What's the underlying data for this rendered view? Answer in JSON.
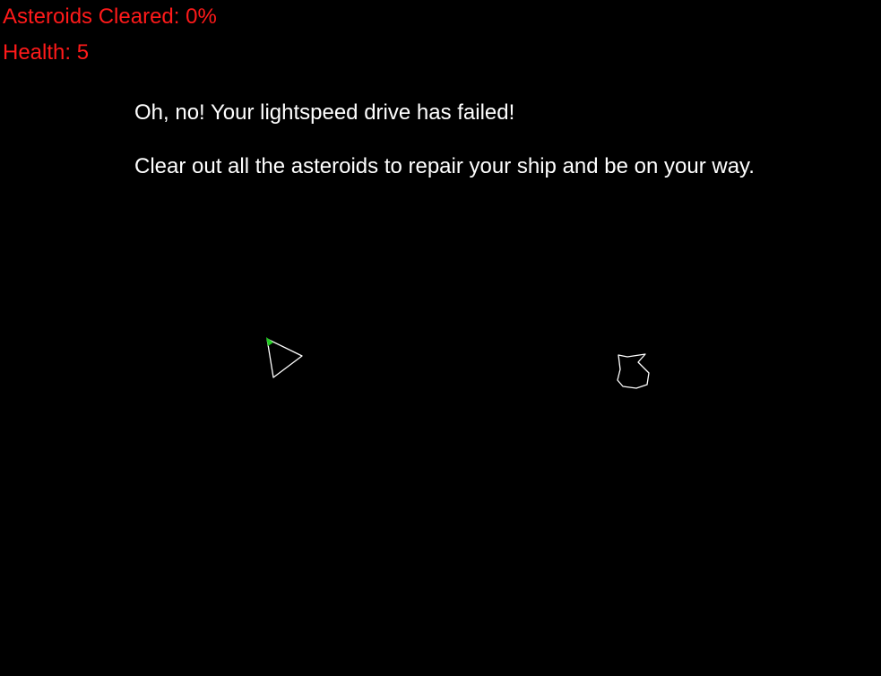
{
  "hud": {
    "cleared_label": "Asteroids Cleared: ",
    "cleared_value": "0%",
    "health_label": "Health: ",
    "health_value": "5"
  },
  "messages": {
    "line1": "Oh, no! Your lightspeed drive has failed!",
    "line2": "Clear out all the asteroids to repair your ship and be on your way."
  },
  "colors": {
    "background": "#000000",
    "hud_text": "#ff1a1a",
    "message_text": "#ffffff",
    "ship_outline": "#ffffff",
    "ship_nose": "#22cc22",
    "asteroid_outline": "#ffffff"
  },
  "entities": {
    "ship": {
      "name": "player-ship"
    },
    "asteroids": [
      {
        "name": "asteroid"
      }
    ]
  }
}
